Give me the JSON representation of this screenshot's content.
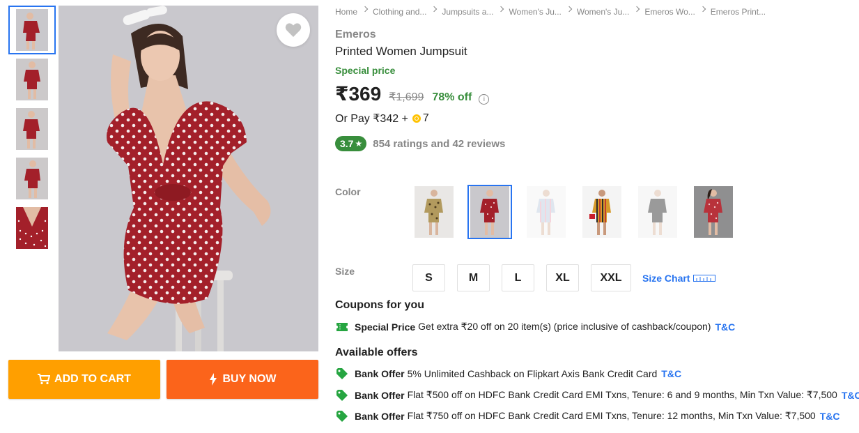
{
  "breadcrumbs": [
    "Home",
    "Clothing and...",
    "Jumpsuits a...",
    "Women's Ju...",
    "Women's Ju...",
    "Emeros Wo...",
    "Emeros Print..."
  ],
  "product": {
    "brand": "Emeros",
    "title": "Printed Women Jumpsuit",
    "special_label": "Special price",
    "price": "₹369",
    "mrp": "₹1,699",
    "discount": "78% off",
    "info_icon": "i",
    "or_pay_text": "Or Pay ₹342 +",
    "coins": "7",
    "rating": "3.7",
    "rating_star": "★",
    "rating_text": "854 ratings and 42 reviews"
  },
  "buttons": {
    "add_to_cart": "ADD TO CART",
    "buy_now": "BUY NOW"
  },
  "color": {
    "label": "Color",
    "options": [
      "leopard",
      "red polka dot",
      "pastel stripe",
      "multicolor stripe",
      "black",
      "red floral"
    ],
    "selected_index": 1
  },
  "size": {
    "label": "Size",
    "options": [
      "S",
      "M",
      "L",
      "XL",
      "XXL"
    ],
    "chart_label": "Size Chart"
  },
  "coupons": {
    "heading": "Coupons for you",
    "items": [
      {
        "title": "Special Price",
        "text": "Get extra ₹20 off on 20 item(s) (price inclusive of cashback/coupon)",
        "tc": "T&C"
      }
    ]
  },
  "offers": {
    "heading": "Available offers",
    "items": [
      {
        "title": "Bank Offer",
        "text": "5% Unlimited Cashback on Flipkart Axis Bank Credit Card",
        "tc": "T&C"
      },
      {
        "title": "Bank Offer",
        "text": "Flat ₹500 off on HDFC Bank Credit Card EMI Txns, Tenure: 6 and 9 months, Min Txn Value: ₹7,500",
        "tc": "T&C"
      },
      {
        "title": "Bank Offer",
        "text": "Flat ₹750 off on HDFC Bank Credit Card EMI Txns, Tenure: 12 months, Min Txn Value: ₹7,500",
        "tc": "T&C"
      }
    ]
  },
  "colors": {
    "accent": "#2874f0",
    "green": "#388e3c",
    "cart": "#ff9f00",
    "buy": "#fb641b",
    "dress_red": "#a3202a"
  }
}
